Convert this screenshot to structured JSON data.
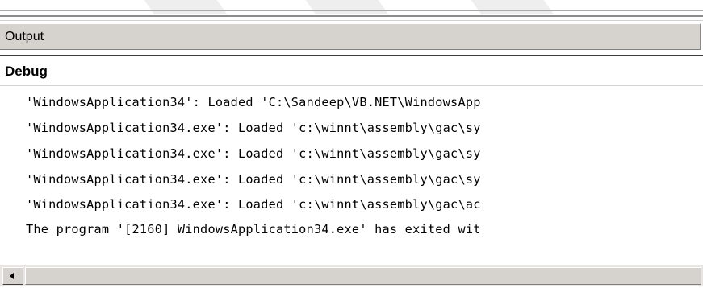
{
  "output_pane": {
    "title": "Output",
    "selected_source": "Debug",
    "lines": [
      "'WindowsApplication34': Loaded 'C:\\Sandeep\\VB.NET\\WindowsApp",
      "'WindowsApplication34.exe': Loaded 'c:\\winnt\\assembly\\gac\\sy",
      "'WindowsApplication34.exe': Loaded 'c:\\winnt\\assembly\\gac\\sy",
      "'WindowsApplication34.exe': Loaded 'c:\\winnt\\assembly\\gac\\sy",
      "'WindowsApplication34.exe': Loaded 'c:\\winnt\\assembly\\gac\\ac",
      "The program '[2160] WindowsApplication34.exe' has exited wit"
    ]
  },
  "scrollbar": {
    "left_arrow_icon": "scroll-left-arrow"
  },
  "colors": {
    "chrome": "#d6d3ce",
    "text": "#000000",
    "background": "#ffffff"
  }
}
